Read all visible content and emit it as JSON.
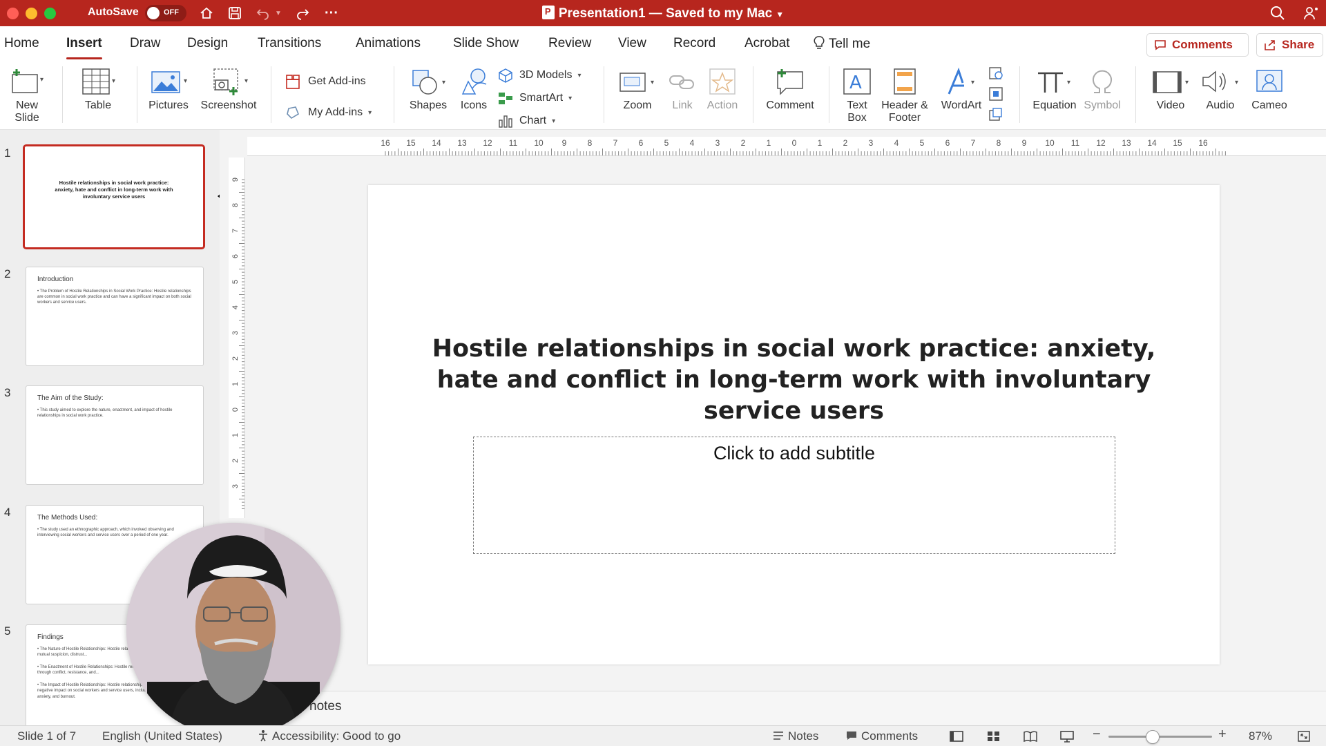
{
  "titlebar": {
    "autosave_label": "AutoSave",
    "autosave_state": "OFF",
    "document_title": "Presentation1 — Saved to my Mac",
    "accent_color": "#b7261e"
  },
  "menu": {
    "tabs": [
      "Home",
      "Insert",
      "Draw",
      "Design",
      "Transitions",
      "Animations",
      "Slide Show",
      "Review",
      "View",
      "Record",
      "Acrobat",
      "Tell me"
    ],
    "active_tab": "Insert",
    "comments_button": "Comments",
    "share_button": "Share"
  },
  "ribbon": {
    "new_slide": [
      "New",
      "Slide"
    ],
    "table": "Table",
    "pictures": "Pictures",
    "screenshot": "Screenshot",
    "get_addins": "Get Add-ins",
    "my_addins": "My Add-ins",
    "shapes": "Shapes",
    "icons": "Icons",
    "models_3d": "3D Models",
    "smartart": "SmartArt",
    "chart": "Chart",
    "zoom": "Zoom",
    "link": "Link",
    "action": "Action",
    "comment": "Comment",
    "text_box": [
      "Text",
      "Box"
    ],
    "header_footer": [
      "Header &",
      "Footer"
    ],
    "wordart": "WordArt",
    "equation": "Equation",
    "symbol": "Symbol",
    "video": "Video",
    "audio": "Audio",
    "cameo": "Cameo"
  },
  "ruler": {
    "horizontal": [
      "16",
      "15",
      "14",
      "13",
      "12",
      "11",
      "10",
      "9",
      "8",
      "7",
      "6",
      "5",
      "4",
      "3",
      "2",
      "1",
      "0",
      "1",
      "2",
      "3",
      "4",
      "5",
      "6",
      "7",
      "8",
      "9",
      "10",
      "11",
      "12",
      "13",
      "14",
      "15",
      "16"
    ],
    "vertical": [
      "9",
      "8",
      "7",
      "6",
      "5",
      "4",
      "3",
      "2",
      "1",
      "0",
      "1",
      "2",
      "3"
    ]
  },
  "slides": [
    {
      "number": "1",
      "center_title": "Hostile relationships in social work practice: anxiety, hate and conflict in long-term work with involuntary service users",
      "selected": true
    },
    {
      "number": "2",
      "title": "Introduction",
      "bullets": [
        "• The Problem of Hostile Relationships in Social Work Practice: Hostile relationships are common in social work practice and can have a significant impact on both social workers and service users."
      ]
    },
    {
      "number": "3",
      "title": "The Aim of the Study:",
      "bullets": [
        "• This study aimed to explore the nature, enactment, and impact of hostile relationships in social work practice."
      ]
    },
    {
      "number": "4",
      "title": "The Methods Used:",
      "bullets": [
        "• The study used an ethnographic approach, which involved observing and interviewing social workers and service users over a period of one year."
      ]
    },
    {
      "number": "5",
      "title": "Findings",
      "bullets": [
        "• The Nature of Hostile Relationships: Hostile relationships were characterized by mutual suspicion, distrust...",
        "• The Enactment of Hostile Relationships: Hostile relationships were often enacted through conflict, resistance, and...",
        "• The Impact of Hostile Relationships: Hostile relationships had a significant negative impact on social workers and service users, including increased stress, anxiety, and burnout."
      ]
    }
  ],
  "slide": {
    "title": "Hostile relationships in social work practice: anxiety, hate and conflict in long-term work with involuntary service users",
    "subtitle_placeholder": "Click to add subtitle"
  },
  "notes_placeholder": "notes",
  "statusbar": {
    "slide_info": "Slide 1 of 7",
    "language": "English (United States)",
    "accessibility": "Accessibility: Good to go",
    "notes": "Notes",
    "comments": "Comments",
    "zoom_level": "87%"
  }
}
